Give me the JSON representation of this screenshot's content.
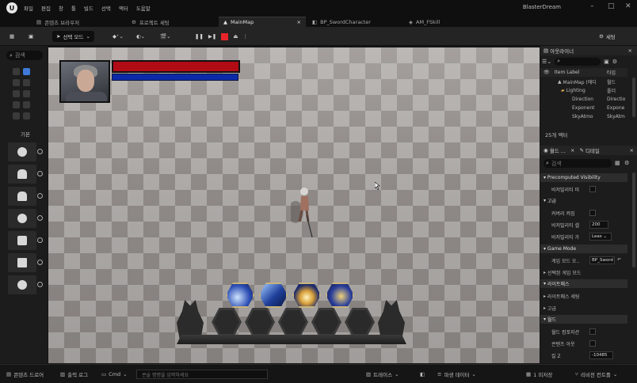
{
  "app_title": "BlasterDream",
  "menu": [
    "파일",
    "편집",
    "창",
    "툴",
    "빌드",
    "선택",
    "액터",
    "도움말"
  ],
  "tabs": [
    {
      "label": "콘텐츠 브라우저"
    },
    {
      "label": "프로젝트 세팅"
    },
    {
      "label": "MainMap"
    },
    {
      "label": "BP_SwordCharacter"
    },
    {
      "label": "AM_FSkill"
    }
  ],
  "toolbar": {
    "mode": "선택 모드",
    "settings": "세팅"
  },
  "viewport": {
    "hp_fraction": 1.0,
    "mp_fraction": 1.0,
    "hp_color": "#b10b15",
    "mp_color": "#0c2aa8",
    "skills": [
      "slash-skill",
      "sword-skill",
      "burst-skill",
      "wave-skill"
    ],
    "slots": 5
  },
  "left_panel": {
    "search_placeholder": "검색",
    "section": "기본"
  },
  "outliner": {
    "title": "아웃라이너",
    "col_label": "Item Label",
    "col_type": "타입",
    "items": [
      {
        "label": "MainMap (에디",
        "type": "월드"
      },
      {
        "label": "Lighting",
        "type": "폴더"
      },
      {
        "label": "Direction",
        "type": "Directio"
      },
      {
        "label": "Exponent",
        "type": "Expone"
      },
      {
        "label": "SkyAtmo",
        "type": "SkyAtm"
      }
    ],
    "count": "25개 액터"
  },
  "details": {
    "tab1": "월드 ...",
    "tab2": "디테일",
    "search_placeholder": "검색",
    "sections": {
      "precomputed": "Precomputed Visibility",
      "general": "고급",
      "game_mode": "Game Mode",
      "selected_gamemode": "선택된 게임 모드",
      "lightmass": "라이트매스",
      "lightmass_settings": "라이트매스 세팅",
      "advanced": "고급",
      "world": "월드"
    },
    "props": {
      "precomputed_vis": "비저빌리티 미",
      "use_client": "커버리 켜짐",
      "cell_size": "비저빌리티 셀",
      "cell_size_val": "200",
      "aggr": "비저빌리티 가",
      "aggr_val": "Leas",
      "gamemode_override": "게임 모드 오..",
      "gamemode_val": "BP_Sword",
      "enable_world_comp": "월드 컴포지션",
      "enable_world_bound": "콘텐츠 아웃",
      "kill_z": "킬 Z",
      "kill_z_val": "-10485"
    }
  },
  "statusbar": {
    "content_drawer": "콘텐츠 드로어",
    "output_log": "출력 로그",
    "cmd": "Cmd",
    "cmd_placeholder": "콘솔 명령을 입력하세요",
    "trace": "트레이스",
    "derived": "파생 데이터",
    "unsaved": "1 미저장",
    "source_control": "리비전 컨트롤"
  }
}
